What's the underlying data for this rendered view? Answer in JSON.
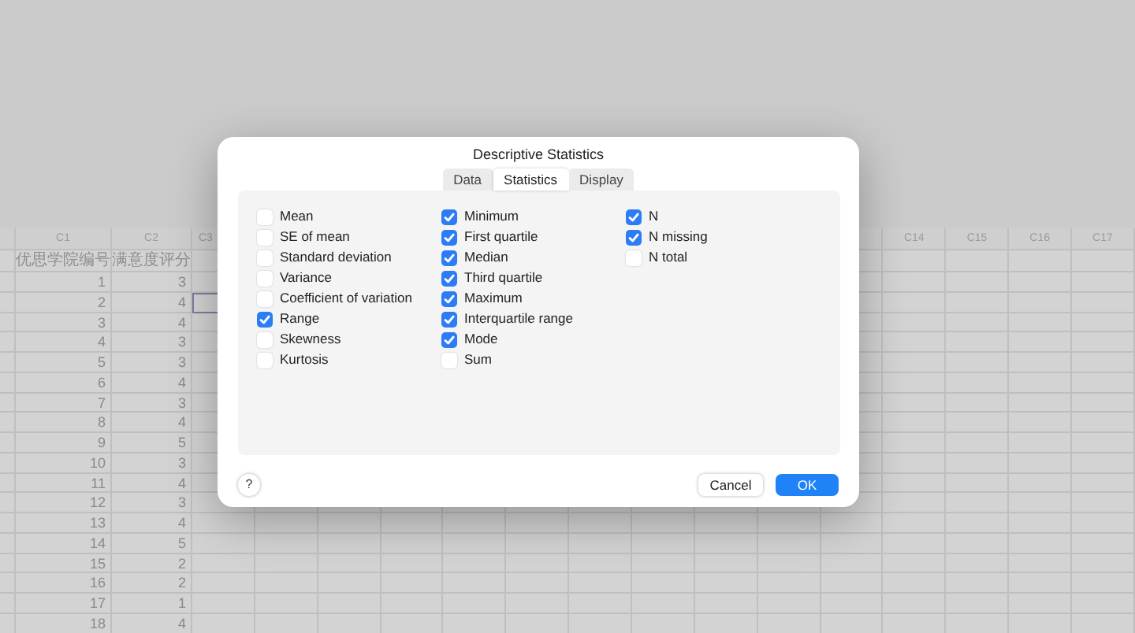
{
  "worksheet": {
    "columns_left": [
      "C1",
      "C2",
      "C3"
    ],
    "columns_right": [
      "C14",
      "C15",
      "C16",
      "C17"
    ],
    "column_names": [
      "优思学院编号",
      "满意度评分"
    ],
    "rows": [
      {
        "cells": [
          "1",
          "3"
        ],
        "c3_active": false
      },
      {
        "cells": [
          "2",
          "4"
        ],
        "c3_active": true
      },
      {
        "cells": [
          "3",
          "4"
        ],
        "c3_active": false
      },
      {
        "cells": [
          "4",
          "3"
        ],
        "c3_active": false
      },
      {
        "cells": [
          "5",
          "3"
        ],
        "c3_active": false
      },
      {
        "cells": [
          "6",
          "4"
        ],
        "c3_active": false
      },
      {
        "cells": [
          "7",
          "3"
        ],
        "c3_active": false
      },
      {
        "cells": [
          "8",
          "4"
        ],
        "c3_active": false
      },
      {
        "cells": [
          "9",
          "5"
        ],
        "c3_active": false
      },
      {
        "cells": [
          "10",
          "3"
        ],
        "c3_active": false
      },
      {
        "cells": [
          "11",
          "4"
        ],
        "c3_active": false
      },
      {
        "cells": [
          "12",
          "3"
        ],
        "c3_active": false
      },
      {
        "cells": [
          "13",
          "4"
        ],
        "c3_active": false
      },
      {
        "cells": [
          "14",
          "5"
        ],
        "c3_active": false
      },
      {
        "cells": [
          "15",
          "2"
        ],
        "c3_active": false
      },
      {
        "cells": [
          "16",
          "2"
        ],
        "c3_active": false
      },
      {
        "cells": [
          "17",
          "1"
        ],
        "c3_active": false
      },
      {
        "cells": [
          "18",
          "4"
        ],
        "c3_active": false
      }
    ]
  },
  "dialog": {
    "title": "Descriptive Statistics",
    "tabs": [
      {
        "label": "Data",
        "selected": false
      },
      {
        "label": "Statistics",
        "selected": true
      },
      {
        "label": "Display",
        "selected": false
      }
    ],
    "option_columns": [
      [
        {
          "label": "Mean",
          "checked": false
        },
        {
          "label": "SE of mean",
          "checked": false
        },
        {
          "label": "Standard deviation",
          "checked": false
        },
        {
          "label": "Variance",
          "checked": false
        },
        {
          "label": "Coefficient of variation",
          "checked": false
        },
        {
          "label": "Range",
          "checked": true
        },
        {
          "label": "Skewness",
          "checked": false
        },
        {
          "label": "Kurtosis",
          "checked": false
        }
      ],
      [
        {
          "label": "Minimum",
          "checked": true
        },
        {
          "label": "First quartile",
          "checked": true
        },
        {
          "label": "Median",
          "checked": true
        },
        {
          "label": "Third quartile",
          "checked": true
        },
        {
          "label": "Maximum",
          "checked": true
        },
        {
          "label": "Interquartile range",
          "checked": true
        },
        {
          "label": "Mode",
          "checked": true
        },
        {
          "label": "Sum",
          "checked": false
        }
      ],
      [
        {
          "label": "N",
          "checked": true
        },
        {
          "label": "N missing",
          "checked": true
        },
        {
          "label": "N total",
          "checked": false
        }
      ]
    ],
    "help": "?",
    "buttons": [
      {
        "label": "Cancel",
        "kind": "secondary"
      },
      {
        "label": "OK",
        "kind": "primary"
      }
    ]
  }
}
